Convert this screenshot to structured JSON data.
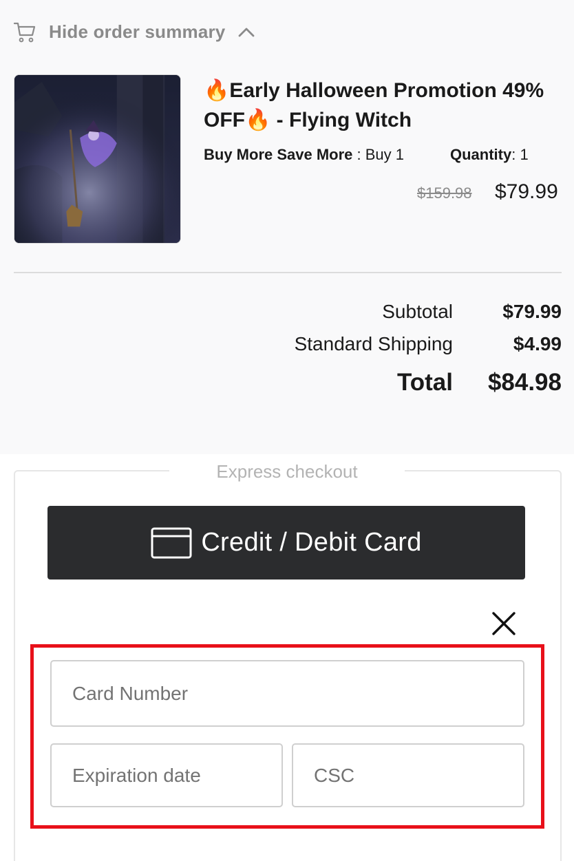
{
  "order_summary": {
    "toggle_label": "Hide order summary",
    "cart_icon": "cart-icon",
    "toggle_icon": "chevron-up-icon"
  },
  "product": {
    "title": "🔥Early Halloween Promotion 49% OFF🔥 - Flying Witch",
    "option_label": "Buy More Save More",
    "option_value": " : Buy 1",
    "quantity_label": "Quantity",
    "quantity_value": ": 1",
    "original_price": "$159.98",
    "price": "$79.99"
  },
  "totals": {
    "subtotal_label": "Subtotal",
    "subtotal_value": "$79.99",
    "shipping_label": "Standard Shipping",
    "shipping_value": "$4.99",
    "total_label": "Total",
    "total_value": "$84.98"
  },
  "express_checkout": {
    "legend": "Express checkout",
    "card_button_label": "Credit / Debit Card",
    "card_button_icon": "credit-card-icon",
    "close_icon": "close-icon"
  },
  "card_form": {
    "card_number_placeholder": "Card Number",
    "expiration_placeholder": "Expiration date",
    "csc_placeholder": "CSC",
    "highlight_color": "#e8101a"
  }
}
